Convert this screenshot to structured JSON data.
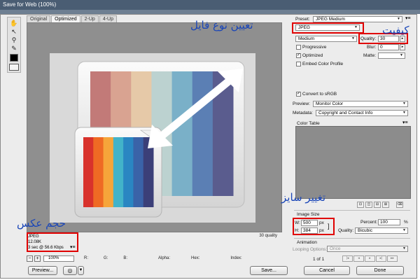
{
  "window": {
    "title": "Save for Web (100%)"
  },
  "tabs": [
    "Original",
    "Optimized",
    "2-Up",
    "4-Up"
  ],
  "active_tab": "Optimized",
  "tools": {
    "hand": "hand-icon",
    "slice_select": "slice-select-icon",
    "zoom": "zoom-icon",
    "eyedropper": "eyedropper-icon"
  },
  "preview": {
    "image": {
      "stripes_top": [
        "#c27a78",
        "#d9a391",
        "#e6c9a8",
        "#bcd2d0",
        "#7ab0c8",
        "#5b7fb4",
        "#5a5c8e"
      ],
      "stripes_bottom": [
        "#d8322c",
        "#ef6a24",
        "#f6a53a",
        "#42b3c9",
        "#2a86c2",
        "#3a63a8",
        "#3b3f78"
      ]
    },
    "quality_note": "30 quality",
    "info": {
      "format": "JPEG",
      "size": "12.08K",
      "time": "3 sec @ 56.6 Kbps",
      "menu": "▾≡"
    }
  },
  "statusbar": {
    "zoom": "100%",
    "r": "R:",
    "g": "G:",
    "b": "B:",
    "alpha": "Alpha:",
    "hex": "Hex:",
    "index": "Index:",
    "minus": "−",
    "plus": "+"
  },
  "buttons": {
    "preview": "Preview...",
    "save": "Save...",
    "cancel": "Cancel",
    "done": "Done",
    "browser_icon": "browser-icon"
  },
  "settings": {
    "preset_label": "Preset:",
    "preset_value": "JPEG Medium",
    "format_value": "JPEG",
    "quality_level": "Medium",
    "quality_label": "Quality:",
    "quality_value": "30",
    "progressive_label": "Progressive",
    "progressive_checked": false,
    "blur_label": "Blur:",
    "blur_value": "0",
    "optimized_label": "Optimized",
    "optimized_checked": true,
    "matte_label": "Matte:",
    "embed_label": "Embed Color Profile",
    "embed_checked": false,
    "srgb_label": "Convert to sRGB",
    "srgb_checked": true,
    "preview_label": "Preview:",
    "preview_value": "Monitor Color",
    "metadata_label": "Metadata:",
    "metadata_value": "Copyright and Contact Info",
    "color_table_label": "Color Table"
  },
  "image_size": {
    "title": "Image Size",
    "w_label": "W:",
    "w_value": "500",
    "h_label": "H:",
    "h_value": "384",
    "unit": "px",
    "percent_label": "Percent:",
    "percent_value": "100",
    "percent_unit": "%",
    "quality_label": "Quality:",
    "quality_value": "Bicubic"
  },
  "animation": {
    "title": "Animation",
    "looping_label": "Looping Options:",
    "looping_value": "Once",
    "frame_counter": "1 of 1"
  },
  "annotations": {
    "file_type": "تعیین نوع فایل",
    "quality": "کیفیت",
    "resize": "تغییر سایز",
    "image_size": "حجم عکس"
  },
  "colors": {
    "highlight": "#e00000",
    "annotation_text": "#1a46b8"
  }
}
